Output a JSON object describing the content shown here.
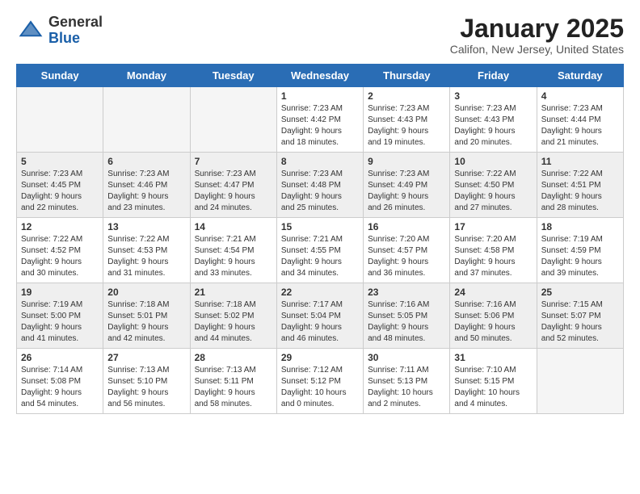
{
  "header": {
    "logo_general": "General",
    "logo_blue": "Blue",
    "month_title": "January 2025",
    "location": "Califon, New Jersey, United States"
  },
  "days_of_week": [
    "Sunday",
    "Monday",
    "Tuesday",
    "Wednesday",
    "Thursday",
    "Friday",
    "Saturday"
  ],
  "weeks": [
    [
      {
        "day": "",
        "info": ""
      },
      {
        "day": "",
        "info": ""
      },
      {
        "day": "",
        "info": ""
      },
      {
        "day": "1",
        "info": "Sunrise: 7:23 AM\nSunset: 4:42 PM\nDaylight: 9 hours\nand 18 minutes."
      },
      {
        "day": "2",
        "info": "Sunrise: 7:23 AM\nSunset: 4:43 PM\nDaylight: 9 hours\nand 19 minutes."
      },
      {
        "day": "3",
        "info": "Sunrise: 7:23 AM\nSunset: 4:43 PM\nDaylight: 9 hours\nand 20 minutes."
      },
      {
        "day": "4",
        "info": "Sunrise: 7:23 AM\nSunset: 4:44 PM\nDaylight: 9 hours\nand 21 minutes."
      }
    ],
    [
      {
        "day": "5",
        "info": "Sunrise: 7:23 AM\nSunset: 4:45 PM\nDaylight: 9 hours\nand 22 minutes."
      },
      {
        "day": "6",
        "info": "Sunrise: 7:23 AM\nSunset: 4:46 PM\nDaylight: 9 hours\nand 23 minutes."
      },
      {
        "day": "7",
        "info": "Sunrise: 7:23 AM\nSunset: 4:47 PM\nDaylight: 9 hours\nand 24 minutes."
      },
      {
        "day": "8",
        "info": "Sunrise: 7:23 AM\nSunset: 4:48 PM\nDaylight: 9 hours\nand 25 minutes."
      },
      {
        "day": "9",
        "info": "Sunrise: 7:23 AM\nSunset: 4:49 PM\nDaylight: 9 hours\nand 26 minutes."
      },
      {
        "day": "10",
        "info": "Sunrise: 7:22 AM\nSunset: 4:50 PM\nDaylight: 9 hours\nand 27 minutes."
      },
      {
        "day": "11",
        "info": "Sunrise: 7:22 AM\nSunset: 4:51 PM\nDaylight: 9 hours\nand 28 minutes."
      }
    ],
    [
      {
        "day": "12",
        "info": "Sunrise: 7:22 AM\nSunset: 4:52 PM\nDaylight: 9 hours\nand 30 minutes."
      },
      {
        "day": "13",
        "info": "Sunrise: 7:22 AM\nSunset: 4:53 PM\nDaylight: 9 hours\nand 31 minutes."
      },
      {
        "day": "14",
        "info": "Sunrise: 7:21 AM\nSunset: 4:54 PM\nDaylight: 9 hours\nand 33 minutes."
      },
      {
        "day": "15",
        "info": "Sunrise: 7:21 AM\nSunset: 4:55 PM\nDaylight: 9 hours\nand 34 minutes."
      },
      {
        "day": "16",
        "info": "Sunrise: 7:20 AM\nSunset: 4:57 PM\nDaylight: 9 hours\nand 36 minutes."
      },
      {
        "day": "17",
        "info": "Sunrise: 7:20 AM\nSunset: 4:58 PM\nDaylight: 9 hours\nand 37 minutes."
      },
      {
        "day": "18",
        "info": "Sunrise: 7:19 AM\nSunset: 4:59 PM\nDaylight: 9 hours\nand 39 minutes."
      }
    ],
    [
      {
        "day": "19",
        "info": "Sunrise: 7:19 AM\nSunset: 5:00 PM\nDaylight: 9 hours\nand 41 minutes."
      },
      {
        "day": "20",
        "info": "Sunrise: 7:18 AM\nSunset: 5:01 PM\nDaylight: 9 hours\nand 42 minutes."
      },
      {
        "day": "21",
        "info": "Sunrise: 7:18 AM\nSunset: 5:02 PM\nDaylight: 9 hours\nand 44 minutes."
      },
      {
        "day": "22",
        "info": "Sunrise: 7:17 AM\nSunset: 5:04 PM\nDaylight: 9 hours\nand 46 minutes."
      },
      {
        "day": "23",
        "info": "Sunrise: 7:16 AM\nSunset: 5:05 PM\nDaylight: 9 hours\nand 48 minutes."
      },
      {
        "day": "24",
        "info": "Sunrise: 7:16 AM\nSunset: 5:06 PM\nDaylight: 9 hours\nand 50 minutes."
      },
      {
        "day": "25",
        "info": "Sunrise: 7:15 AM\nSunset: 5:07 PM\nDaylight: 9 hours\nand 52 minutes."
      }
    ],
    [
      {
        "day": "26",
        "info": "Sunrise: 7:14 AM\nSunset: 5:08 PM\nDaylight: 9 hours\nand 54 minutes."
      },
      {
        "day": "27",
        "info": "Sunrise: 7:13 AM\nSunset: 5:10 PM\nDaylight: 9 hours\nand 56 minutes."
      },
      {
        "day": "28",
        "info": "Sunrise: 7:13 AM\nSunset: 5:11 PM\nDaylight: 9 hours\nand 58 minutes."
      },
      {
        "day": "29",
        "info": "Sunrise: 7:12 AM\nSunset: 5:12 PM\nDaylight: 10 hours\nand 0 minutes."
      },
      {
        "day": "30",
        "info": "Sunrise: 7:11 AM\nSunset: 5:13 PM\nDaylight: 10 hours\nand 2 minutes."
      },
      {
        "day": "31",
        "info": "Sunrise: 7:10 AM\nSunset: 5:15 PM\nDaylight: 10 hours\nand 4 minutes."
      },
      {
        "day": "",
        "info": ""
      }
    ]
  ]
}
